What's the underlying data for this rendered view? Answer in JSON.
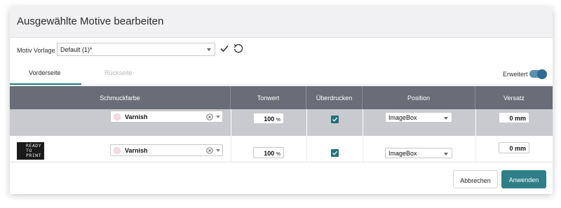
{
  "dialog": {
    "title": "Ausgewählte Motive bearbeiten",
    "template_label": "Motiv Vorlage",
    "template_value": "Default (1)*",
    "confirm_icon": "check-icon",
    "reset_icon": "reset-icon"
  },
  "tabs": [
    {
      "label": "Vorderseite",
      "active": true
    },
    {
      "label": "Rückseite",
      "active": false
    }
  ],
  "advanced": {
    "label": "Erweitert",
    "enabled": true
  },
  "table": {
    "columns": [
      "Schmuckfarbe",
      "Tonwert",
      "Überdrucken",
      "Position",
      "Versatz"
    ],
    "rows": [
      {
        "color": "Varnish",
        "tonwert": "100",
        "tonwert_unit": "%",
        "overprint": true,
        "position": "ImageBox",
        "offset": "0 mm",
        "thumbnail": null
      },
      {
        "color": "Varnish",
        "tonwert": "100",
        "tonwert_unit": "%",
        "overprint": true,
        "position": "ImageBox",
        "offset": "0 mm",
        "thumbnail": "READY TO PRINT"
      }
    ]
  },
  "buttons": {
    "cancel": "Abbrechen",
    "apply": "Anwenden"
  },
  "colors": {
    "accent": "#2e7f88",
    "header_bg": "#6a6d78",
    "selected_row": "#c9cacf",
    "swatch": "#f6dbe4"
  }
}
